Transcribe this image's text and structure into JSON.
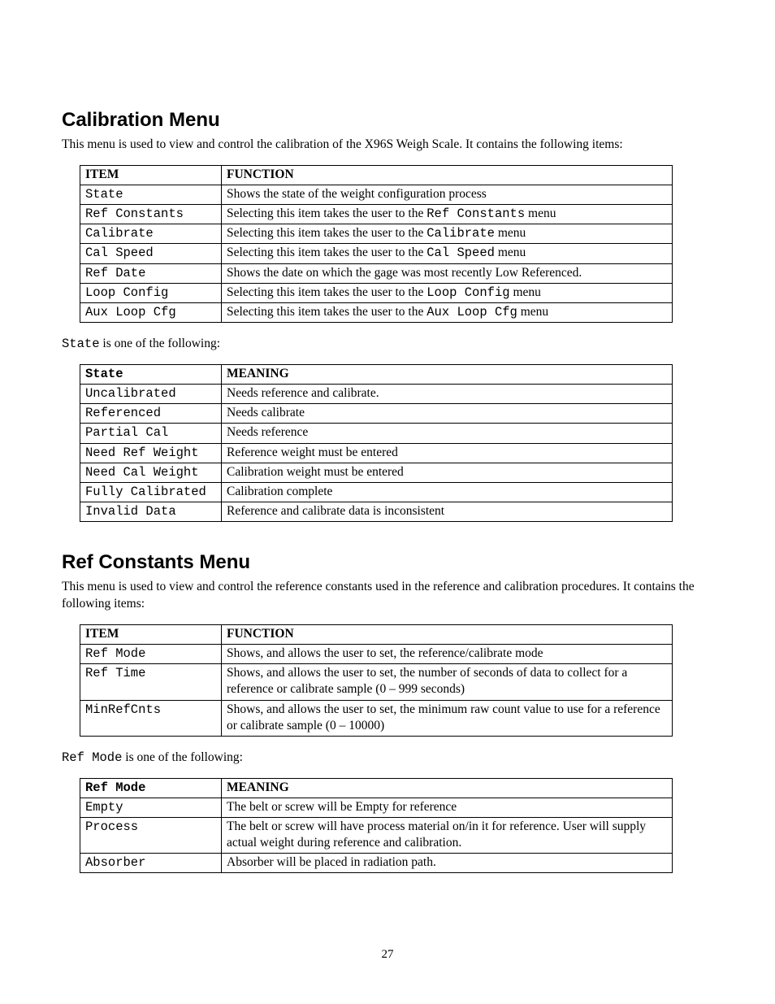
{
  "section1": {
    "heading": "Calibration Menu",
    "intro": "This menu is used to view and control the calibration of the X96S Weigh Scale.  It contains the following items:"
  },
  "table1": {
    "h1": "ITEM",
    "h2": "FUNCTION",
    "rows": [
      {
        "item": "State",
        "func_pre": "Shows the state of the weight configuration process",
        "code": "",
        "func_post": ""
      },
      {
        "item": "Ref Constants",
        "func_pre": "Selecting this item takes the user to the ",
        "code": "Ref Constants",
        "func_post": " menu"
      },
      {
        "item": "Calibrate",
        "func_pre": "Selecting this item takes the user to the ",
        "code": "Calibrate",
        "func_post": " menu"
      },
      {
        "item": "Cal Speed",
        "func_pre": "Selecting this item takes the user to the ",
        "code": "Cal Speed",
        "func_post": " menu"
      },
      {
        "item": "Ref Date",
        "func_pre": "Shows the date on which the gage was most recently Low Referenced.",
        "code": "",
        "func_post": ""
      },
      {
        "item": "Loop Config",
        "func_pre": "Selecting this item takes the user to the ",
        "code": "Loop Config",
        "func_post": " menu"
      },
      {
        "item": "Aux Loop Cfg",
        "func_pre": "Selecting this item takes the user to the ",
        "code": "Aux Loop Cfg",
        "func_post": " menu"
      }
    ]
  },
  "note1": {
    "code": "State",
    "text": " is one of the following:"
  },
  "table2": {
    "h1": "State",
    "h2": "MEANING",
    "rows": [
      {
        "item": "Uncalibrated",
        "meaning": "Needs reference and calibrate."
      },
      {
        "item": "Referenced",
        "meaning": "Needs calibrate"
      },
      {
        "item": "Partial Cal",
        "meaning": "Needs reference"
      },
      {
        "item": "Need Ref Weight",
        "meaning": "Reference weight must be entered"
      },
      {
        "item": "Need Cal Weight",
        "meaning": "Calibration weight must be entered"
      },
      {
        "item": "Fully Calibrated",
        "meaning": "Calibration complete"
      },
      {
        "item": "Invalid Data",
        "meaning": "Reference and calibrate data is inconsistent"
      }
    ]
  },
  "section2": {
    "heading": "Ref Constants Menu",
    "intro": "This menu is used to view and control the reference constants used in the reference and calibration procedures.  It contains the following items:"
  },
  "table3": {
    "h1": "ITEM",
    "h2": "FUNCTION",
    "rows": [
      {
        "item": "Ref Mode",
        "func": "Shows, and allows the user to set,  the reference/calibrate mode"
      },
      {
        "item": "Ref Time",
        "func": "Shows, and allows the user to set,  the number of seconds of data to collect for a reference or calibrate sample (0 – 999 seconds)"
      },
      {
        "item": "MinRefCnts",
        "func": "Shows, and allows the user to set,  the minimum raw count value to use for a reference or calibrate sample (0 – 10000)"
      }
    ]
  },
  "note2": {
    "code": "Ref Mode",
    "text": " is one of the following:"
  },
  "table4": {
    "h1": "Ref Mode",
    "h2": "MEANING",
    "rows": [
      {
        "item": "Empty",
        "meaning": "The belt or screw will be Empty for reference"
      },
      {
        "item": "Process",
        "meaning": "The belt or screw will have process material on/in it for reference.  User will supply actual weight during reference and calibration."
      },
      {
        "item": "Absorber",
        "meaning": "Absorber will be placed in radiation path."
      }
    ]
  },
  "pagenum": "27"
}
